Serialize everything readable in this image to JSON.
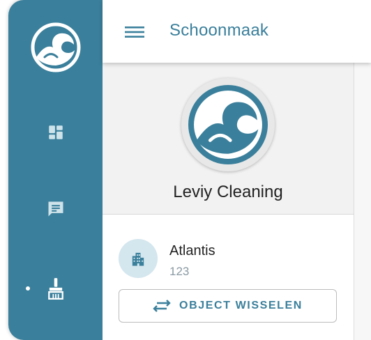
{
  "topbar": {
    "title": "Schoonmaak",
    "menu_icon": "hamburger-menu-icon"
  },
  "rail": {
    "logo_icon": "wave-logo-icon",
    "items": [
      {
        "icon": "dashboard-icon",
        "active": false
      },
      {
        "icon": "chat-icon",
        "active": false
      },
      {
        "icon": "cleaning-brush-icon",
        "active": true
      }
    ]
  },
  "profile": {
    "company_name": "Leviy Cleaning",
    "avatar_icon": "wave-logo-icon"
  },
  "object": {
    "name": "Atlantis",
    "code": "123",
    "icon": "building-icon"
  },
  "switch_button": {
    "label": "OBJECT WISSELEN",
    "icon": "swap-arrows-icon"
  },
  "colors": {
    "brand": "#3a7f9b",
    "avatar_bg": "#d4e6ee"
  }
}
